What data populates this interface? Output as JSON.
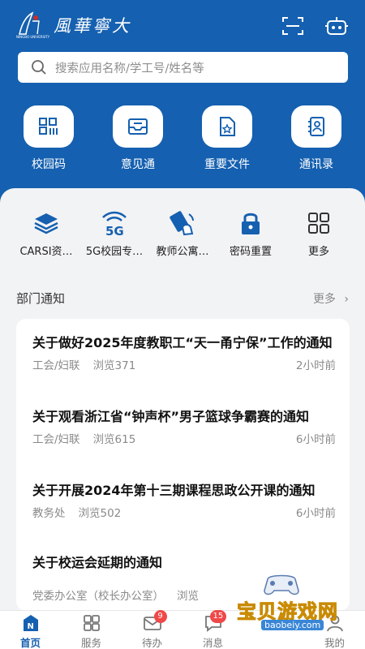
{
  "header": {
    "logo_text": "風華寧大",
    "logo_small": "NINGBO UNIVERSITY",
    "bg_color": "#1560b0"
  },
  "search": {
    "placeholder": "搜索应用名称/学工号/姓名等"
  },
  "quick_actions": [
    {
      "label": "校园码",
      "icon": "qr-grid-icon"
    },
    {
      "label": "意见通",
      "icon": "inbox-icon"
    },
    {
      "label": "重要文件",
      "icon": "star-file-icon"
    },
    {
      "label": "通讯录",
      "icon": "contact-book-icon"
    }
  ],
  "services": [
    {
      "label": "CARSI资…",
      "icon": "layers-icon"
    },
    {
      "label": "5G校园专…",
      "icon": "5g-icon"
    },
    {
      "label": "教师公寓…",
      "icon": "card-tap-icon"
    },
    {
      "label": "密码重置",
      "icon": "lock-icon"
    },
    {
      "label": "更多",
      "icon": "apps-grid-icon"
    }
  ],
  "notices_section": {
    "title": "部门通知",
    "more": "更多"
  },
  "notices": [
    {
      "title": "关于做好2025年度教职工“天一甬宁保”工作的通知",
      "source": "工会/妇联",
      "views": "浏览371",
      "time": "2小时前"
    },
    {
      "title": "关于观看浙江省“钟声杯”男子篮球争霸赛的通知",
      "source": "工会/妇联",
      "views": "浏览615",
      "time": "6小时前"
    },
    {
      "title": "关于开展2024年第十三期课程思政公开课的通知",
      "source": "教务处",
      "views": "浏览502",
      "time": "6小时前"
    },
    {
      "title": "关于校运会延期的通知",
      "source": "党委办公室（校长办公室）",
      "views": "浏览",
      "time": ""
    }
  ],
  "tabs": [
    {
      "label": "首页",
      "icon": "home-n-icon",
      "badge": ""
    },
    {
      "label": "服务",
      "icon": "grid-icon",
      "badge": ""
    },
    {
      "label": "待办",
      "icon": "envelope-icon",
      "badge": "9"
    },
    {
      "label": "消息",
      "icon": "chat-icon",
      "badge": "15"
    },
    {
      "label": "",
      "icon": "hidden-icon",
      "badge": ""
    },
    {
      "label": "我的",
      "icon": "user-icon",
      "badge": ""
    }
  ],
  "watermark": {
    "text": "宝贝游戏网",
    "sub": "baobeiy.com"
  }
}
